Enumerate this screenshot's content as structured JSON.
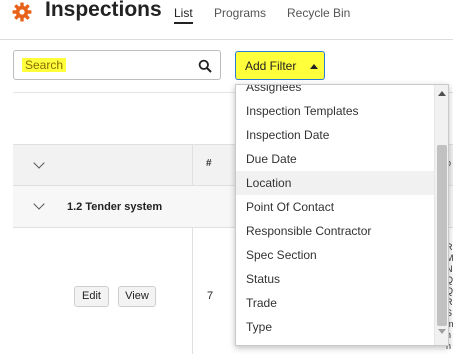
{
  "header": {
    "title": "Inspections",
    "tabs": [
      {
        "label": "List",
        "active": true
      },
      {
        "label": "Programs",
        "active": false
      },
      {
        "label": "Recycle Bin",
        "active": false
      }
    ],
    "gear_icon": "gear-icon",
    "accent_color": "#e8631a"
  },
  "toolbar": {
    "search_placeholder": "Search",
    "search_icon": "search-icon",
    "add_filter_label": "Add Filter",
    "highlight_color": "#ffff3c"
  },
  "table": {
    "hash_header": "#",
    "group_label": "1.2 Tender system",
    "row": {
      "edit_label": "Edit",
      "view_label": "View",
      "number": "7"
    }
  },
  "dropdown": {
    "items": [
      "Assignees",
      "Inspection Templates",
      "Inspection Date",
      "Due Date",
      "Location",
      "Point Of Contact",
      "Responsible Contractor",
      "Spec Section",
      "Status",
      "Trade",
      "Type"
    ],
    "highlighted": "Location"
  },
  "edge_fragment": {
    "header": "o",
    "lines": [
      "R",
      "M",
      "N",
      "Q",
      "Q",
      "R",
      "S",
      "m",
      "n",
      "n"
    ]
  }
}
